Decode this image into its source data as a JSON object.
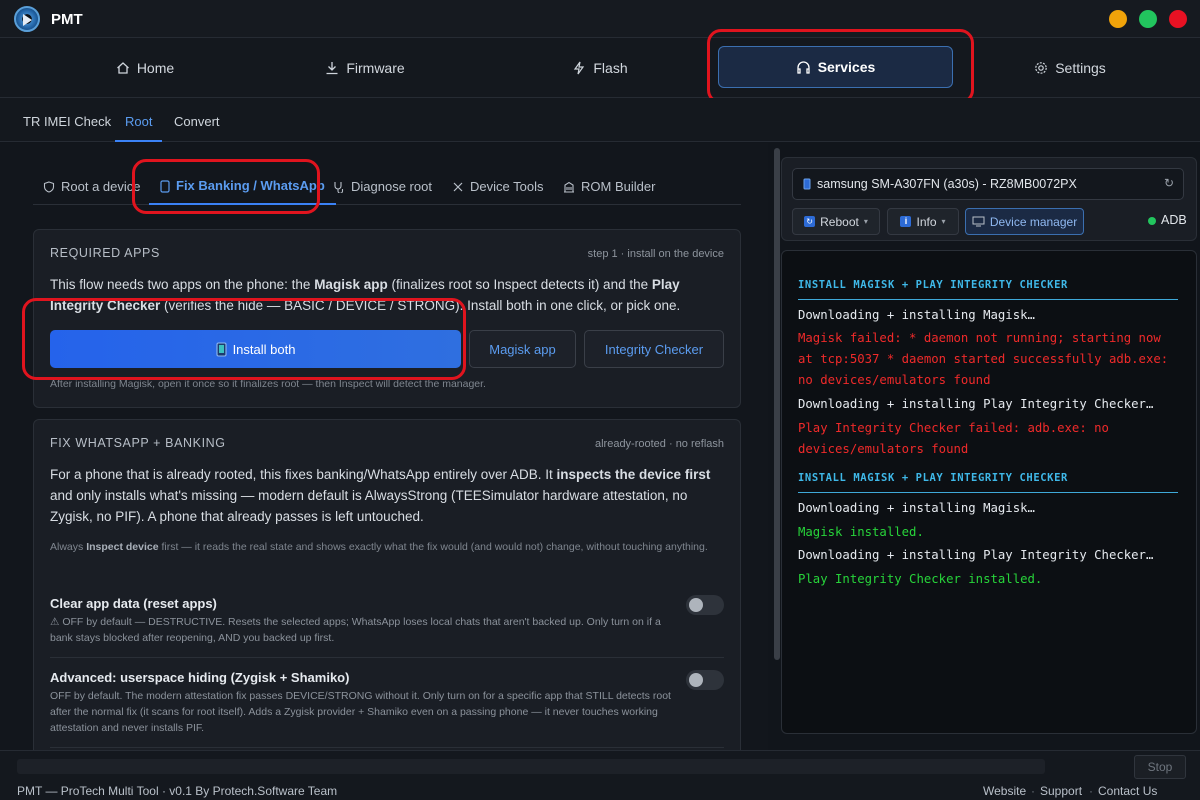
{
  "app": {
    "title": "PMT"
  },
  "window_controls": {
    "minimize_color": "#f0a30a",
    "maximize_color": "#22c55e",
    "close_color": "#e81123"
  },
  "nav": {
    "items": [
      {
        "label": "Home",
        "icon": "home-icon"
      },
      {
        "label": "Firmware",
        "icon": "download-icon"
      },
      {
        "label": "Flash",
        "icon": "bolt-icon"
      },
      {
        "label": "Services",
        "icon": "headset-icon",
        "active": true
      },
      {
        "label": "Settings",
        "icon": "gear-icon"
      }
    ]
  },
  "subtabs": [
    {
      "label": "TR IMEI Check"
    },
    {
      "label": "Root",
      "active": true
    },
    {
      "label": "Convert"
    }
  ],
  "inner_tabs": [
    {
      "label": "Root a device",
      "icon": "shield-icon"
    },
    {
      "label": "Fix Banking / WhatsApp",
      "icon": "phone-icon",
      "active": true
    },
    {
      "label": "Diagnose root",
      "icon": "stethoscope-icon"
    },
    {
      "label": "Device Tools",
      "icon": "tools-icon"
    },
    {
      "label": "ROM Builder",
      "icon": "building-icon"
    }
  ],
  "required_apps": {
    "heading": "REQUIRED APPS",
    "meta": "step 1 · install on the device",
    "desc_part1": "This flow needs two apps on the phone: the ",
    "desc_bold1": "Magisk app",
    "desc_part2": " (finalizes root so Inspect detects it) and the ",
    "desc_bold2": "Play Integrity Checker",
    "desc_part3": " (verifies the hide — BASIC / DEVICE / STRONG). Install both in one click, or pick one.",
    "install_both": "Install both",
    "magisk_app": "Magisk app",
    "integrity_checker": "Integrity Checker",
    "note": "After installing Magisk, open it once so it finalizes root — then Inspect will detect the manager."
  },
  "fix_section": {
    "heading": "FIX WHATSAPP + BANKING",
    "meta": "already-rooted · no reflash",
    "desc_part1": "For a phone that is already rooted, this fixes banking/WhatsApp entirely over ADB. It ",
    "desc_bold": "inspects the device first",
    "desc_part2": " and only installs what's missing — modern default is AlwaysStrong (TEESimulator hardware attestation, no Zygisk, no PIF). A phone that already passes is left untouched.",
    "hint_part1": "Always ",
    "hint_bold": "Inspect device",
    "hint_part2": " first — it reads the real state and shows exactly what the fix would (and would not) change, without touching anything.",
    "options": [
      {
        "title": "Clear app data (reset apps)",
        "desc": "⚠ OFF by default — DESTRUCTIVE. Resets the selected apps; WhatsApp loses local chats that aren't backed up. Only turn on if a bank stays blocked after reopening, AND you backed up first.",
        "enabled": false
      },
      {
        "title": "Advanced: userspace hiding (Zygisk + Shamiko)",
        "desc": "OFF by default. The modern attestation fix passes DEVICE/STRONG without it. Only turn on for a specific app that STILL detects root after the normal fix (it scans for root itself). Adds a Zygisk provider + Shamiko even on a passing phone — it never touches working attestation and never installs PIF.",
        "enabled": false
      }
    ]
  },
  "device": {
    "selected": "samsung SM-A307FN (a30s) - RZ8MB0072PX",
    "reboot": "Reboot",
    "info": "Info",
    "device_manager": "Device manager",
    "connection": "ADB",
    "connection_color": "#22c55e"
  },
  "console": {
    "lines": [
      {
        "type": "head",
        "text": "INSTALL MAGISK + PLAY INTEGRITY CHECKER"
      },
      {
        "type": "info",
        "text": "Downloading + installing Magisk…"
      },
      {
        "type": "error",
        "text": "Magisk failed: * daemon not running; starting now at tcp:5037 * daemon started successfully adb.exe: no devices/emulators found"
      },
      {
        "type": "info",
        "text": "Downloading + installing Play Integrity Checker…"
      },
      {
        "type": "error",
        "text": "Play Integrity Checker failed: adb.exe: no devices/emulators found"
      },
      {
        "type": "head",
        "text": "INSTALL MAGISK + PLAY INTEGRITY CHECKER"
      },
      {
        "type": "info",
        "text": "Downloading + installing Magisk…"
      },
      {
        "type": "success",
        "text": "Magisk installed."
      },
      {
        "type": "info",
        "text": "Downloading + installing Play Integrity Checker…"
      },
      {
        "type": "success",
        "text": "Play Integrity Checker installed."
      }
    ]
  },
  "footer": {
    "stop": "Stop",
    "credits": "PMT — ProTech Multi Tool · v0.1 By Protech.Software Team",
    "links": [
      "Website",
      "Support",
      "Contact Us"
    ],
    "separator": "·"
  }
}
